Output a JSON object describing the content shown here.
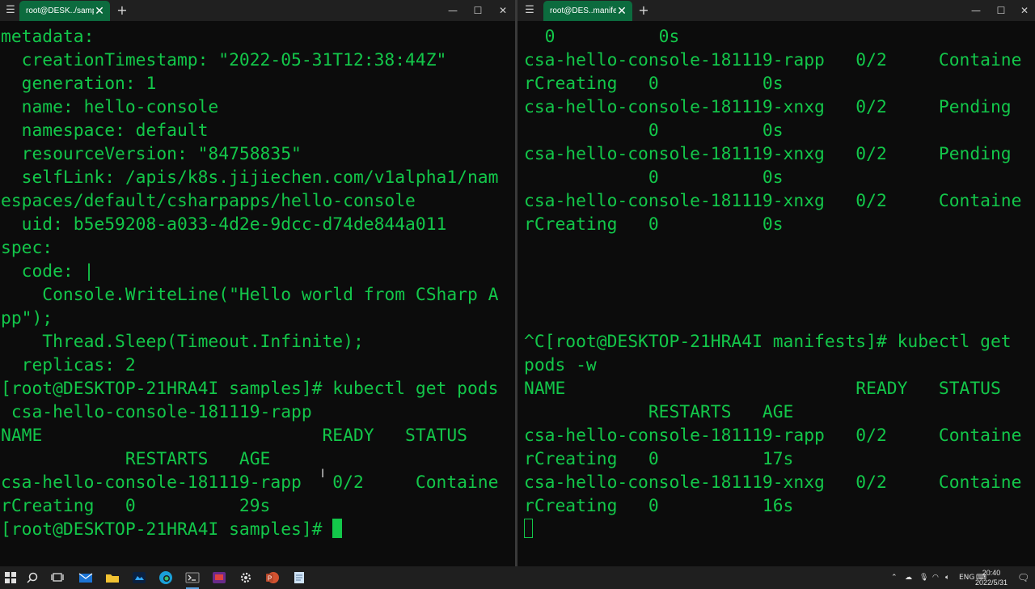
{
  "left_window": {
    "tab_title": "root@DESK../samples",
    "lines": [
      "metadata:",
      "  creationTimestamp: \"2022-05-31T12:38:44Z\"",
      "  generation: 1",
      "  name: hello-console",
      "  namespace: default",
      "  resourceVersion: \"84758835\"",
      "  selfLink: /apis/k8s.jijiechen.com/v1alpha1/nam",
      "espaces/default/csharpapps/hello-console",
      "  uid: b5e59208-a033-4d2e-9dcc-d74de844a011",
      "spec:",
      "  code: |",
      "    Console.WriteLine(\"Hello world from CSharp A",
      "pp\");",
      "    Thread.Sleep(Timeout.Infinite);",
      "  replicas: 2",
      "[root@DESKTOP-21HRA4I samples]# kubectl get pods",
      " csa-hello-console-181119-rapp",
      "NAME                           READY   STATUS",
      "            RESTARTS   AGE",
      "csa-hello-console-181119-rapp   0/2     Containe",
      "rCreating   0          29s"
    ],
    "prompt": "[root@DESKTOP-21HRA4I samples]# "
  },
  "right_window": {
    "tab_title": "root@DES..manifests",
    "lines": [
      "  0          0s",
      "csa-hello-console-181119-rapp   0/2     Containe",
      "rCreating   0          0s",
      "csa-hello-console-181119-xnxg   0/2     Pending",
      "            0          0s",
      "csa-hello-console-181119-xnxg   0/2     Pending",
      "            0          0s",
      "csa-hello-console-181119-xnxg   0/2     Containe",
      "rCreating   0          0s",
      "",
      "",
      "",
      "",
      "^C[root@DESKTOP-21HRA4I manifests]# kubectl get",
      "pods -w",
      "NAME                            READY   STATUS",
      "            RESTARTS   AGE",
      "csa-hello-console-181119-rapp   0/2     Containe",
      "rCreating   0          17s",
      "csa-hello-console-181119-xnxg   0/2     Containe",
      "rCreating   0          16s"
    ]
  },
  "taskbar": {
    "icons": [
      "windows-start-icon",
      "search-icon",
      "task-view-icon",
      "mail-icon",
      "file-explorer-icon",
      "photoshop-icon",
      "edge-icon",
      "terminal-icon",
      "rdp-icon",
      "settings-icon",
      "powerpoint-icon",
      "notepad-icon"
    ],
    "language": "ENG",
    "time": "20:40",
    "date": "2022/5/31"
  },
  "colors": {
    "terminal_text": "#13c74a",
    "tab_active": "#0c6b3e",
    "terminal_bg": "#0c0c0c"
  }
}
